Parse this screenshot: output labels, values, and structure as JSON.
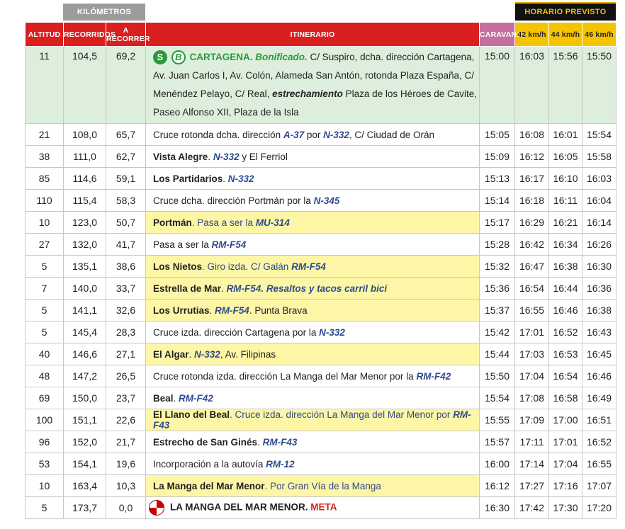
{
  "header": {
    "km_group": "KILÓMETROS",
    "horario_group": "HORARIO PREVISTO",
    "cols": {
      "altitud": "ALTITUD",
      "recorridos": "RECORRIDOS",
      "a_recorrer": "A RECORRER",
      "itinerario": "ITINERARIO",
      "caravana": "CARAVANA",
      "s42": "42 km/h",
      "s44": "44 km/h",
      "s46": "46 km/h"
    }
  },
  "colors": {
    "red": "#d9201f",
    "green": "#2a9a3a",
    "yellow": "#f5c400",
    "highlight": "#fdf6a6",
    "caravana": "#c46fa0"
  },
  "badges": {
    "s": "S",
    "b": "B"
  },
  "rows": [
    {
      "alt": "11",
      "rec": "104,5",
      "arec": "69,2",
      "car": "15:00",
      "t42": "16:03",
      "t44": "15:56",
      "t46": "15:50",
      "it": {
        "a": "CARTAGENA",
        "b": ". ",
        "c": "Bonificado.",
        "d": " C/ Suspiro, dcha. dirección Cartagena, Av. Juan Carlos I, Av. Colón, Alameda San Antón, rotonda Plaza España, C/ Menéndez Pelayo, C/ Real, ",
        "e": "estrechamiento",
        "f": " Plaza de los Héroes de Cavite, Paseo Alfonso XII, Plaza de la Isla"
      }
    },
    {
      "alt": "21",
      "rec": "108,0",
      "arec": "65,7",
      "car": "15:05",
      "t42": "16:08",
      "t44": "16:01",
      "t46": "15:54",
      "it": {
        "a": "Cruce rotonda dcha. dirección ",
        "b": "A-37",
        "c": " por ",
        "d": "N-332",
        "e": ", C/ Ciudad de Orán"
      }
    },
    {
      "alt": "38",
      "rec": "111,0",
      "arec": "62,7",
      "car": "15:09",
      "t42": "16:12",
      "t44": "16:05",
      "t46": "15:58",
      "it": {
        "a": "Vista Alegre",
        "b": ". ",
        "c": "N-332",
        "d": " y El Ferriol"
      }
    },
    {
      "alt": "85",
      "rec": "114,6",
      "arec": "59,1",
      "car": "15:13",
      "t42": "16:17",
      "t44": "16:10",
      "t46": "16:03",
      "it": {
        "a": "Los Partidarios",
        "b": ". ",
        "c": "N-332"
      }
    },
    {
      "alt": "110",
      "rec": "115,4",
      "arec": "58,3",
      "car": "15:14",
      "t42": "16:18",
      "t44": "16:11",
      "t46": "16:04",
      "it": {
        "a": "Cruce dcha. dirección Portmán por la ",
        "b": "N-345"
      }
    },
    {
      "alt": "10",
      "rec": "123,0",
      "arec": "50,7",
      "car": "15:17",
      "t42": "16:29",
      "t44": "16:21",
      "t46": "16:14",
      "it": {
        "a": "Portmán",
        "b": ". Pasa a ser la ",
        "c": "MU-314"
      }
    },
    {
      "alt": "27",
      "rec": "132,0",
      "arec": "41,7",
      "car": "15:28",
      "t42": "16:42",
      "t44": "16:34",
      "t46": "16:26",
      "it": {
        "a": "Pasa a ser la ",
        "b": "RM-F54"
      }
    },
    {
      "alt": "5",
      "rec": "135,1",
      "arec": "38,6",
      "car": "15:32",
      "t42": "16:47",
      "t44": "16:38",
      "t46": "16:30",
      "it": {
        "a": "Los Nietos",
        "b": ". Giro izda. C/ Galán ",
        "c": "RM-F54"
      }
    },
    {
      "alt": "7",
      "rec": "140,0",
      "arec": "33,7",
      "car": "15:36",
      "t42": "16:54",
      "t44": "16:44",
      "t46": "16:36",
      "it": {
        "a": "Estrella de Mar",
        "b": ". ",
        "c": "RM-F54. Resaltos y tacos carril bici"
      }
    },
    {
      "alt": "5",
      "rec": "141,1",
      "arec": "32,6",
      "car": "15:37",
      "t42": "16:55",
      "t44": "16:46",
      "t46": "16:38",
      "it": {
        "a": "Los Urrutias",
        "b": ". ",
        "c": "RM-F54",
        "d": ". Punta Brava"
      }
    },
    {
      "alt": "5",
      "rec": "145,4",
      "arec": "28,3",
      "car": "15:42",
      "t42": "17:01",
      "t44": "16:52",
      "t46": "16:43",
      "it": {
        "a": "Cruce izda. dirección Cartagena por la ",
        "b": "N-332"
      }
    },
    {
      "alt": "40",
      "rec": "146,6",
      "arec": "27,1",
      "car": "15:44",
      "t42": "17:03",
      "t44": "16:53",
      "t46": "16:45",
      "it": {
        "a": "El Algar",
        "b": ". ",
        "c": "N-332",
        "d": ", Av. Filipinas"
      }
    },
    {
      "alt": "48",
      "rec": "147,2",
      "arec": "26,5",
      "car": "15:50",
      "t42": "17:04",
      "t44": "16:54",
      "t46": "16:46",
      "it": {
        "a": "Cruce rotonda izda. dirección La Manga del Mar Menor por la ",
        "b": "RM-F42"
      }
    },
    {
      "alt": "69",
      "rec": "150,0",
      "arec": "23,7",
      "car": "15:54",
      "t42": "17:08",
      "t44": "16:58",
      "t46": "16:49",
      "it": {
        "a": "Beal",
        "b": ". ",
        "c": "RM-F42"
      }
    },
    {
      "alt": "100",
      "rec": "151,1",
      "arec": "22,6",
      "car": "15:55",
      "t42": "17:09",
      "t44": "17:00",
      "t46": "16:51",
      "it": {
        "a": "El Llano del Beal",
        "b": ". Cruce izda. dirección La Manga del Mar Menor por ",
        "c": "RM-F43"
      }
    },
    {
      "alt": "96",
      "rec": "152,0",
      "arec": "21,7",
      "car": "15:57",
      "t42": "17:11",
      "t44": "17:01",
      "t46": "16:52",
      "it": {
        "a": "Estrecho de San Ginés",
        "b": ". ",
        "c": "RM-F43"
      }
    },
    {
      "alt": "53",
      "rec": "154,1",
      "arec": "19,6",
      "car": "16:00",
      "t42": "17:14",
      "t44": "17:04",
      "t46": "16:55",
      "it": {
        "a": "Incorporación a la autovía ",
        "b": "RM-12"
      }
    },
    {
      "alt": "10",
      "rec": "163,4",
      "arec": "10,3",
      "car": "16:12",
      "t42": "17:27",
      "t44": "17:16",
      "t46": "17:07",
      "it": {
        "a": "La Manga del Mar Menor",
        "b": ". Por Gran Vía de la Manga"
      }
    },
    {
      "alt": "5",
      "rec": "173,7",
      "arec": "0,0",
      "car": "16:30",
      "t42": "17:42",
      "t44": "17:30",
      "t46": "17:20",
      "it": {
        "a": "LA MANGA DEL MAR MENOR",
        "b": ". ",
        "c": "META"
      }
    }
  ]
}
